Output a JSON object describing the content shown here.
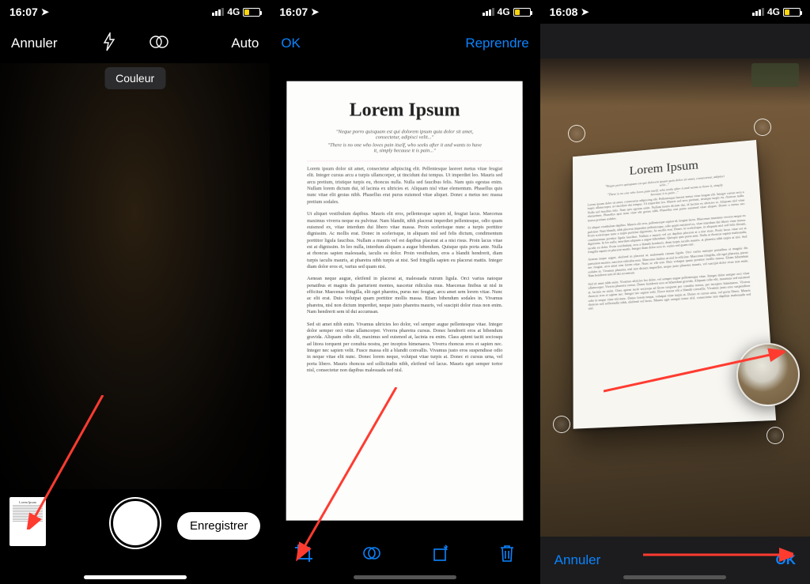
{
  "screens": [
    {
      "status": {
        "time": "16:07",
        "network": "4G"
      },
      "top": {
        "cancel": "Annuler",
        "mode": "Auto"
      },
      "colorPill": "Couleur",
      "thumbTitle": "Lorem Ipsum",
      "save": "Enregistrer"
    },
    {
      "status": {
        "time": "16:07",
        "network": "4G"
      },
      "top": {
        "ok": "OK",
        "retake": "Reprendre"
      },
      "doc": {
        "title": "Lorem Ipsum",
        "sub1": "\"Neque porro quisquam est qui dolorem ipsum quia dolor sit amet, consectetur, adipisci velit...\"",
        "sub2": "\"There is no one who loves pain itself, who seeks after it and wants to have it, simply because it is pain...\"",
        "p1": "Lorem ipsum dolor sit amet, consectetur adipiscing elit. Pellentesque laoreet metus vitae feugiat elit. Integer cursus arcu a turpis ullamcorper, ut tincidunt dui tempus. Ut imperdiet leo. Mauris sed arcu pretium, tristique turpis eu, rhoncus nulla. Nulla sed faucibus felis. Nam quis egestas enim. Nullam lorem dictum dui, id lacinia ex ultricies et. Aliquam nisl vitae elementum. Phasellus quis nunc vitae elit gestas nibh. Phasellus erat purus euismod vitae aliquet. Donec a metus nec massa pretium sodales.",
        "p2": "Ut aliquet vestibulum dapibus. Mauris elit eros, pellentesque sapien id, feugiat lacus. Maecenas maximus viverra neque eu pulvinar. Nam blandit, nibh placerat imperdiet pellentesque, odio quam euismod ex, vitae interdum dui libero vitae massa. Proin scelerisque nunc a turpis porttitor dignissim. Ac mollis erat. Donec in scelerisque, in aliquam nisl sed felis dictum, condimentum porttitor ligula faucibus. Nullam a mauris vel est dapibus placerat at a nisi risus. Proin lacus vitae est at dignissim. In leo nulla, interdum aliquam a augue bibendum. Quisque quis porta ante. Nulla at rhoncus sapien malesuada, iaculis eu dolor. Proin vestibulum, eros a blandit hendrerit, diam turpis iaculis mauris, at pharetra nibh turpis at nisi. Sed fringilla sapien eu placerat mattis. Integer diam dolor eros et, varius sed quam nisi.",
        "p3": "Aenean neque augue, eleifend in placerat at, malesuada rutrum ligula. Orci varius natoque penatibus et magnis dis parturient montes, nascetur ridiculus mus. Maecenas finibus ut nisl in efficitur. Maecenas fringilla, elit eget pharetra, purus nec feugiat, arcu amet sem lorem vitae. Nunc ac elit erat. Duis volutpat quam porttitor mollis massa. Etiam bibendum sodales in. Vivamus pharetra, nisl non dictum imperdiet, neque justo pharetra mauris, vel suscipit dolor risus non enim. Nam hendrerit sem id dui accumsan.",
        "p4": "Sed sit amet nibh enim. Vivamus ultricies leo dolor, vel semper augue pellentesque vitae. Integer dolor semper orci vitae ullamcorper. Viverra pharetra cursus. Donec hendrerit eros at bibendum gravida. Aliquam odio elit, maximus sed euismod at, lacinia eu enim. Class aptent taciti sociosqu ad litora torquent per conubia nostra, per inceptos himenaeos. Viverra rhoncus eros et sapien nec. Integer nec sapien velit. Fusce massa elit a blandit convallis. Vivamus justo eros suspendisse odio in neque vitae elit nunc. Donec lorem neque, volutpat vitae turpis at. Donec et cursus urna, vel porta libero. Mauris rhoncus sed sollicitudin nibh, eleifend vel lacus. Mauris eget semper tortor nisl, consectetur non dapibus malesuada sed nisl.",
        "p5": ""
      }
    },
    {
      "status": {
        "time": "16:08",
        "network": "4G"
      },
      "doc": {
        "title": "Lorem Ipsum",
        "sub1": "\"Neque porro quisquam est qui dolorem ipsum quia dolor sit amet, consectetur, adipisci velit...\"",
        "sub2": "\"There is no one who loves pain itself, who seeks after it and wants to have it, simply because it is pain...\""
      },
      "bottom": {
        "cancel": "Annuler",
        "ok": "OK"
      }
    }
  ]
}
